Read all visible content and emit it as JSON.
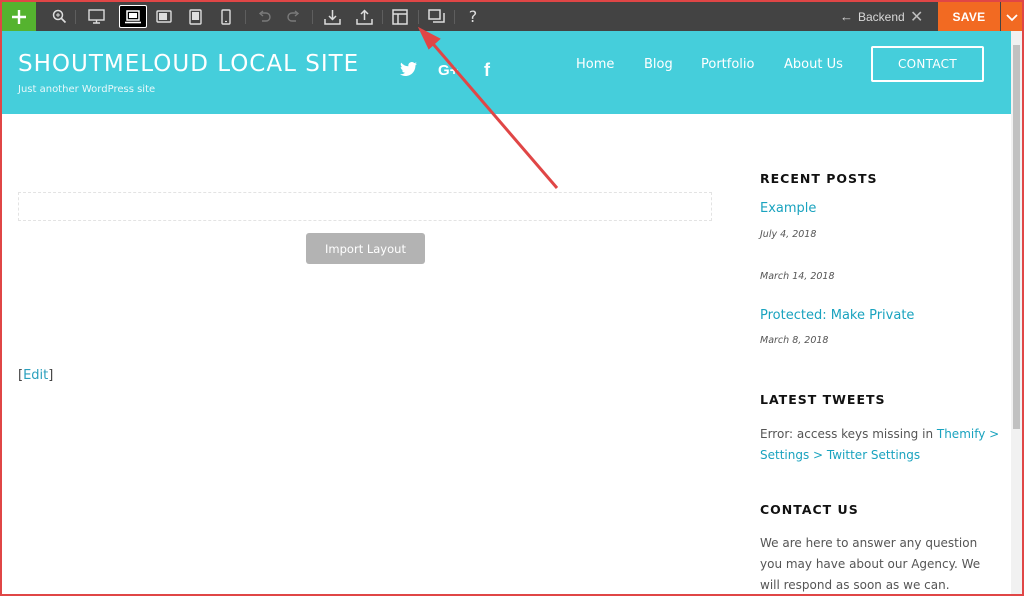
{
  "toolbar": {
    "icons": [
      "plus-icon",
      "zoom-icon",
      "desktop-icon",
      "laptop-icon",
      "tablet-landscape-icon",
      "tablet-portrait-icon",
      "mobile-icon",
      "undo-icon",
      "redo-icon",
      "import-icon",
      "export-icon",
      "layout-icon",
      "duplicate-icon",
      "help-icon"
    ],
    "backend_label": "Backend",
    "save_label": "SAVE",
    "colors": {
      "bar": "#434343",
      "add": "#55b32f",
      "save": "#f26a22"
    }
  },
  "header": {
    "title": "SHOUTMELOUD LOCAL SITE",
    "tagline": "Just another WordPress site",
    "social_icons": [
      "twitter-icon",
      "google-plus-icon",
      "facebook-icon"
    ],
    "twitter_glyph": "🐦",
    "gplus_glyph": "G+",
    "facebook_glyph": "f",
    "nav": [
      "Home",
      "Blog",
      "Portfolio",
      "About Us"
    ],
    "contact_button": "CONTACT",
    "color": "#45cedb"
  },
  "main": {
    "import_layout_label": "Import Layout",
    "edit_open": "[",
    "edit_link": "Edit",
    "edit_close": "]"
  },
  "sidebar": {
    "recent_posts_title": "RECENT POSTS",
    "posts": [
      {
        "title": "Example",
        "date": "July 4, 2018"
      },
      {
        "title": "",
        "date": "March 14, 2018"
      },
      {
        "title": "Protected: Make Private",
        "date": "March 8, 2018"
      }
    ],
    "latest_tweets_title": "LATEST TWEETS",
    "tweet_error": "Error: access keys missing in ",
    "tweet_link": "Themify > Settings > Twitter Settings",
    "contact_title": "CONTACT US",
    "contact_text": "We are here to answer any question you may have about our Agency. We will respond as soon as we can."
  },
  "annotation": {
    "color": "#e04646"
  }
}
